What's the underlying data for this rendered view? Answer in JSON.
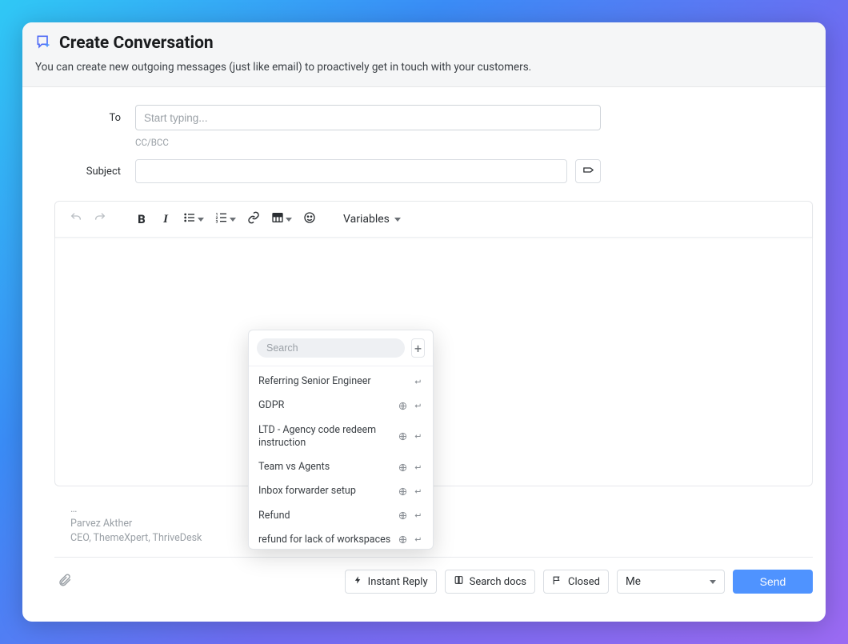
{
  "header": {
    "title": "Create Conversation",
    "subtitle": "You can create new outgoing messages (just like email) to proactively get in touch with your customers."
  },
  "form": {
    "to_label": "To",
    "to_placeholder": "Start typing...",
    "ccbcc": "CC/BCC",
    "subject_label": "Subject"
  },
  "toolbar": {
    "variables_label": "Variables"
  },
  "signature": {
    "line1": "…",
    "line2": "Parvez Akther",
    "line3": "CEO, ThemeXpert, ThriveDesk"
  },
  "footer": {
    "instant_reply_label": "Instant Reply",
    "search_docs_label": "Search docs",
    "closed_label": "Closed",
    "assignee_value": "Me",
    "send_label": "Send"
  },
  "reply_popover": {
    "search_placeholder": "Search",
    "items": [
      {
        "label": "Referring Senior Engineer",
        "globe": false,
        "enter": true
      },
      {
        "label": "GDPR",
        "globe": true,
        "enter": true
      },
      {
        "label": "LTD - Agency code redeem instruction",
        "globe": true,
        "enter": true
      },
      {
        "label": "Team vs Agents",
        "globe": true,
        "enter": true
      },
      {
        "label": "Inbox forwarder setup",
        "globe": true,
        "enter": true
      },
      {
        "label": "Refund",
        "globe": true,
        "enter": true
      },
      {
        "label": "refund for lack of workspaces",
        "globe": true,
        "enter": true
      }
    ]
  }
}
